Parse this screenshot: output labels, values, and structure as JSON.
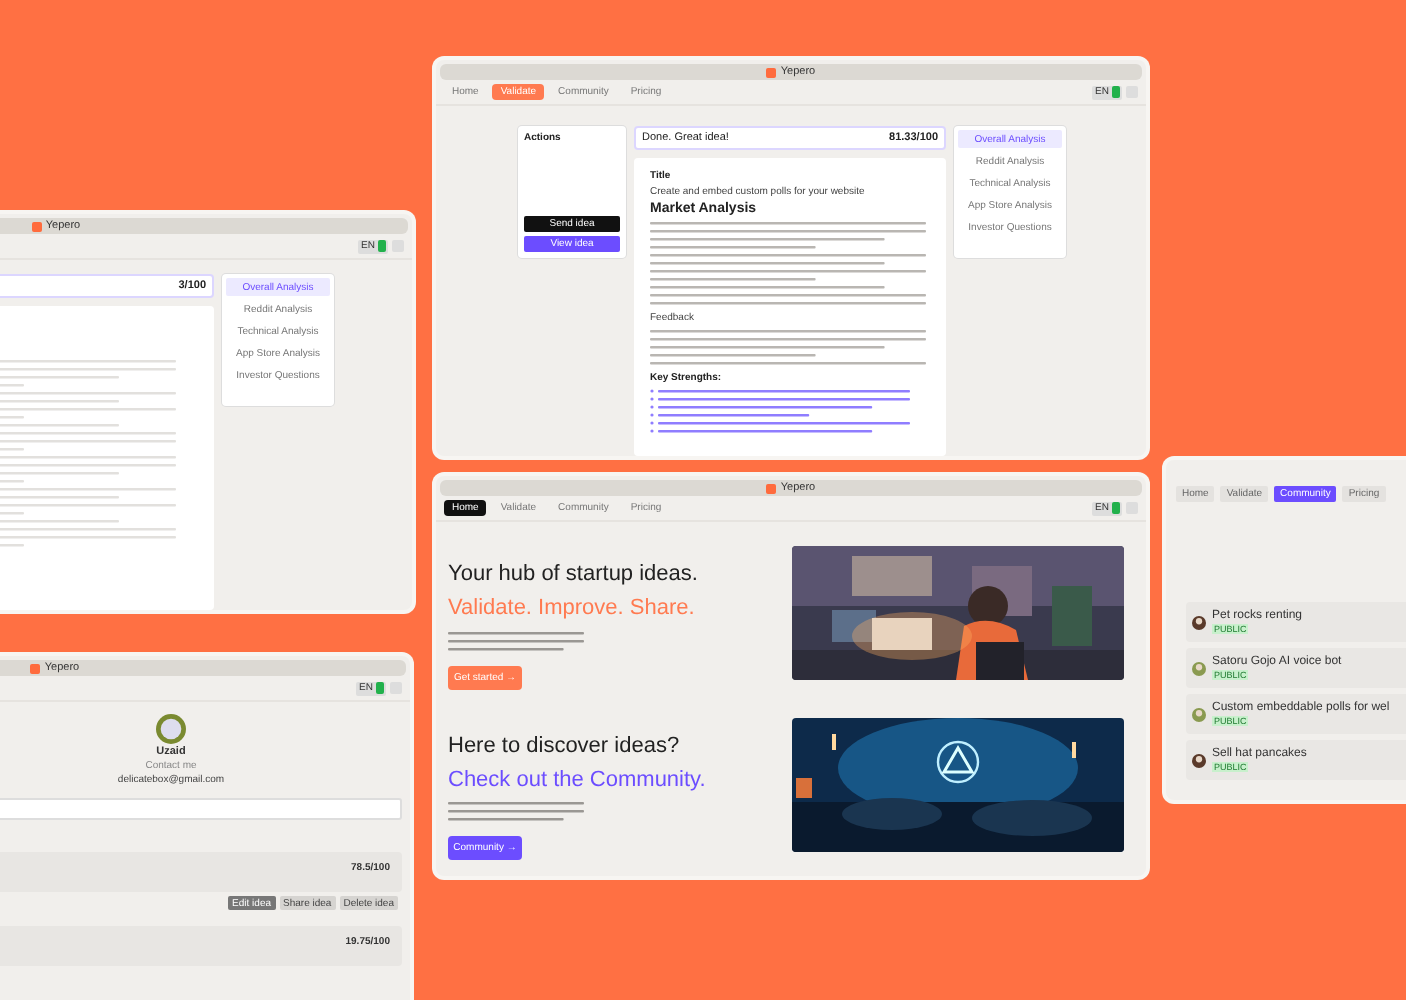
{
  "validator": {
    "title": "Yepero",
    "tabs": [
      {
        "label": "Home",
        "selected": false
      },
      {
        "label": "Validate",
        "selected": true
      },
      {
        "label": "Community",
        "selected": false
      },
      {
        "label": "Pricing",
        "selected": false
      }
    ],
    "lang": "EN",
    "actions_title": "Actions",
    "action_buttons": [
      {
        "label": "Send idea",
        "kind": "dark"
      },
      {
        "label": "View idea",
        "kind": "accent"
      }
    ],
    "result": "Done. Great idea!",
    "score": "81.33/100",
    "menu": [
      {
        "label": "Overall Analysis",
        "selected": true
      },
      {
        "label": "Reddit Analysis",
        "selected": false
      },
      {
        "label": "Technical Analysis",
        "selected": false
      },
      {
        "label": "App Store Analysis",
        "selected": false
      },
      {
        "label": "Investor Questions",
        "selected": false
      }
    ],
    "title_label": "Title",
    "idea_title": "Create and embed custom polls for your website",
    "heading": "Market Analysis",
    "feedback_label": "Feedback",
    "strengths_label": "Key Strengths:"
  },
  "home": {
    "title": "Yepero",
    "tabs": [
      {
        "label": "Home",
        "selected": true
      },
      {
        "label": "Validate",
        "selected": false
      },
      {
        "label": "Community",
        "selected": false
      },
      {
        "label": "Pricing",
        "selected": false
      }
    ],
    "lang": "EN",
    "sections": [
      {
        "headline": "Your hub of startup ideas.",
        "accent": "Validate. Improve. Share.",
        "button": "Get started →"
      },
      {
        "headline": "Here to discover ideas?",
        "accent": "Check out the Community.",
        "button": "Community →"
      }
    ]
  },
  "analysis": {
    "title": "Yepero",
    "lang": "EN",
    "score": "3/100",
    "menu": [
      {
        "label": "Overall Analysis",
        "selected": true
      },
      {
        "label": "Reddit Analysis",
        "selected": false
      },
      {
        "label": "Technical Analysis",
        "selected": false
      },
      {
        "label": "App Store Analysis",
        "selected": false
      },
      {
        "label": "Investor Questions",
        "selected": false
      }
    ]
  },
  "profile": {
    "title": "Yepero",
    "lang": "EN",
    "name": "Uzaid",
    "contact_label": "Contact me",
    "email": "delicatebox@gmail.com",
    "ideas": [
      {
        "score": "78.5/100",
        "buttons": [
          {
            "label": "Edit idea",
            "kind": "dark"
          },
          {
            "label": "Share idea",
            "kind": "light"
          },
          {
            "label": "Delete idea",
            "kind": "light"
          }
        ]
      },
      {
        "score": "19.75/100"
      }
    ]
  },
  "community": {
    "tabs": [
      {
        "label": "Home",
        "selected": false
      },
      {
        "label": "Validate",
        "selected": false
      },
      {
        "label": "Community",
        "selected": true
      },
      {
        "label": "Pricing",
        "selected": false
      }
    ],
    "ideas": [
      {
        "title": "Pet rocks renting",
        "tag": "PUBLIC"
      },
      {
        "title": "Satoru Gojo AI voice bot",
        "tag": "PUBLIC"
      },
      {
        "title": "Custom embeddable polls for wel",
        "tag": "PUBLIC"
      },
      {
        "title": "Sell hat pancakes",
        "tag": "PUBLIC"
      }
    ]
  }
}
